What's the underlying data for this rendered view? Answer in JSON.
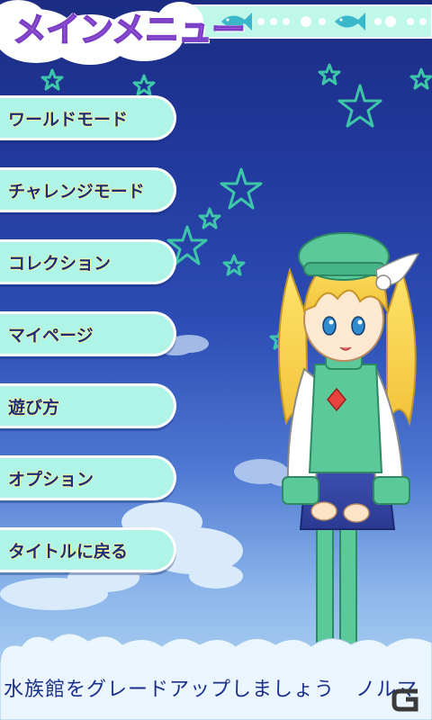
{
  "title": "メインメニュー",
  "menu": {
    "items": [
      {
        "label": "ワールドモード"
      },
      {
        "label": "チャレンジモード"
      },
      {
        "label": "コレクション"
      },
      {
        "label": "マイページ"
      },
      {
        "label": "遊び方"
      },
      {
        "label": "オプション"
      },
      {
        "label": "タイトルに戻る"
      }
    ]
  },
  "ticker": {
    "text": "水族館をグレードアップしましょう　ノルマ"
  },
  "colors": {
    "sky_top": "#1b2c82",
    "sky_bottom": "#b9dcf7",
    "button_fill": "#aef4e7",
    "button_text": "#1a2f7a",
    "title_purple": "#b46ee8",
    "star_outline": "#3ec6a8",
    "character_green": "#5cc99a"
  },
  "icons": {
    "banner_decor": "fish-icon",
    "watermark": "g-logo-icon"
  }
}
